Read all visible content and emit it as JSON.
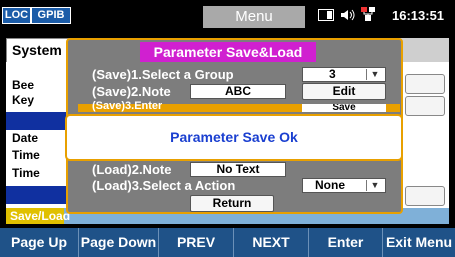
{
  "status": {
    "loc_label": "LOC",
    "gpib_label": "GPIB",
    "menu_title": "Menu",
    "time": "16:13:51"
  },
  "background": {
    "tab_label": "System",
    "labels": [
      "Bee",
      "Key",
      "Date",
      "Time",
      "Time"
    ],
    "bottom_label": "Save/Load"
  },
  "dialog": {
    "title": "Parameter Save&Load",
    "row1_label": "(Save)1.Select a Group",
    "row1_value": "3",
    "row2_label": "(Save)2.Note",
    "row2_value": "ABC",
    "row2_button": "Edit",
    "row3_label": "(Save)3.Enter",
    "row3_button": "Save",
    "row5_label": "(Load)2.Note",
    "row5_value": "No Text",
    "row6_label": "(Load)3.Select a Action",
    "row6_value": "None",
    "return_button": "Return"
  },
  "popup": {
    "message": "Parameter Save Ok"
  },
  "softkeys": [
    "Page Up",
    "Page Down",
    "PREV",
    "NEXT",
    "Enter",
    "Exit Menu"
  ],
  "colors": {
    "dialog_border": "#e8a000",
    "title_bar": "#d020d0",
    "softkey_bg": "#1f5288",
    "popup_text": "#1a3fd0"
  }
}
